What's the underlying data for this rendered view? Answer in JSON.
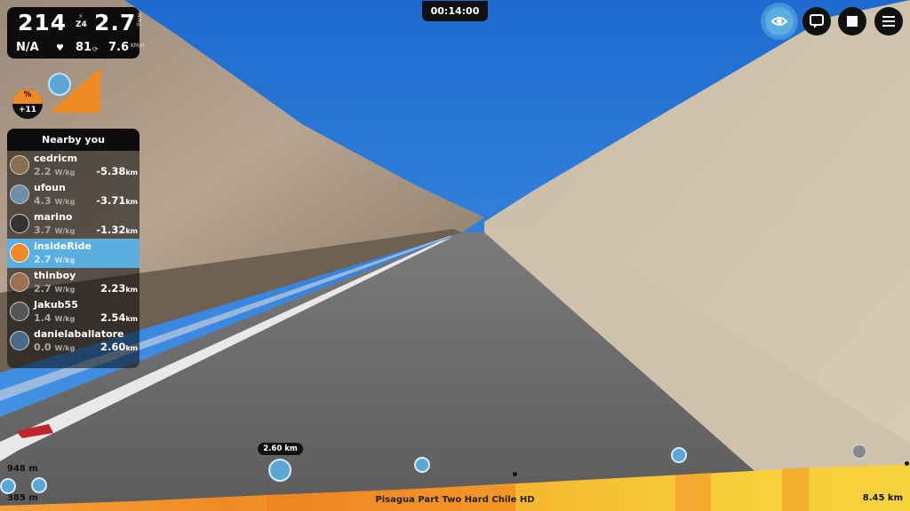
{
  "stats": {
    "power": "214",
    "zone": "Z4",
    "wkg": "2.7",
    "wkg_unit": "W/kg",
    "hr": "N/A",
    "cadence": "81",
    "speed": "7.6",
    "speed_unit": "KM/H"
  },
  "grade": {
    "label": "%",
    "value": "+11"
  },
  "nearby": {
    "title": "Nearby you",
    "wkg_unit": "W/kg",
    "dist_unit": "km",
    "riders": [
      {
        "name": "cedricm",
        "wkg": "2.2",
        "distance": "-5.38",
        "me": false
      },
      {
        "name": "ufoun",
        "wkg": "4.3",
        "distance": "-3.71",
        "me": false
      },
      {
        "name": "marino",
        "wkg": "3.7",
        "distance": "-1.32",
        "me": false
      },
      {
        "name": "insideRide",
        "wkg": "2.7",
        "distance": "",
        "me": true
      },
      {
        "name": "thinboy",
        "wkg": "2.7",
        "distance": "2.23",
        "me": false
      },
      {
        "name": "Jakub55",
        "wkg": "1.4",
        "distance": "2.54",
        "me": false
      },
      {
        "name": "danielaballatore",
        "wkg": "0.0",
        "distance": "2.60",
        "me": false
      }
    ]
  },
  "timer": "00:14:00",
  "route": {
    "title": "Pisagua Part Two Hard Chile HD",
    "max_elev": "948 m",
    "min_elev": "385 m",
    "total_distance": "8.45 km",
    "marker_label": "2.60 km"
  },
  "icons": {
    "view": "eye-icon",
    "chat": "chat-icon",
    "stop": "stop-icon",
    "menu": "menu-icon"
  },
  "colors": {
    "accent": "#5aaee0",
    "grade_orange": "#f08a24",
    "profile_yellow": "#f5c630"
  }
}
